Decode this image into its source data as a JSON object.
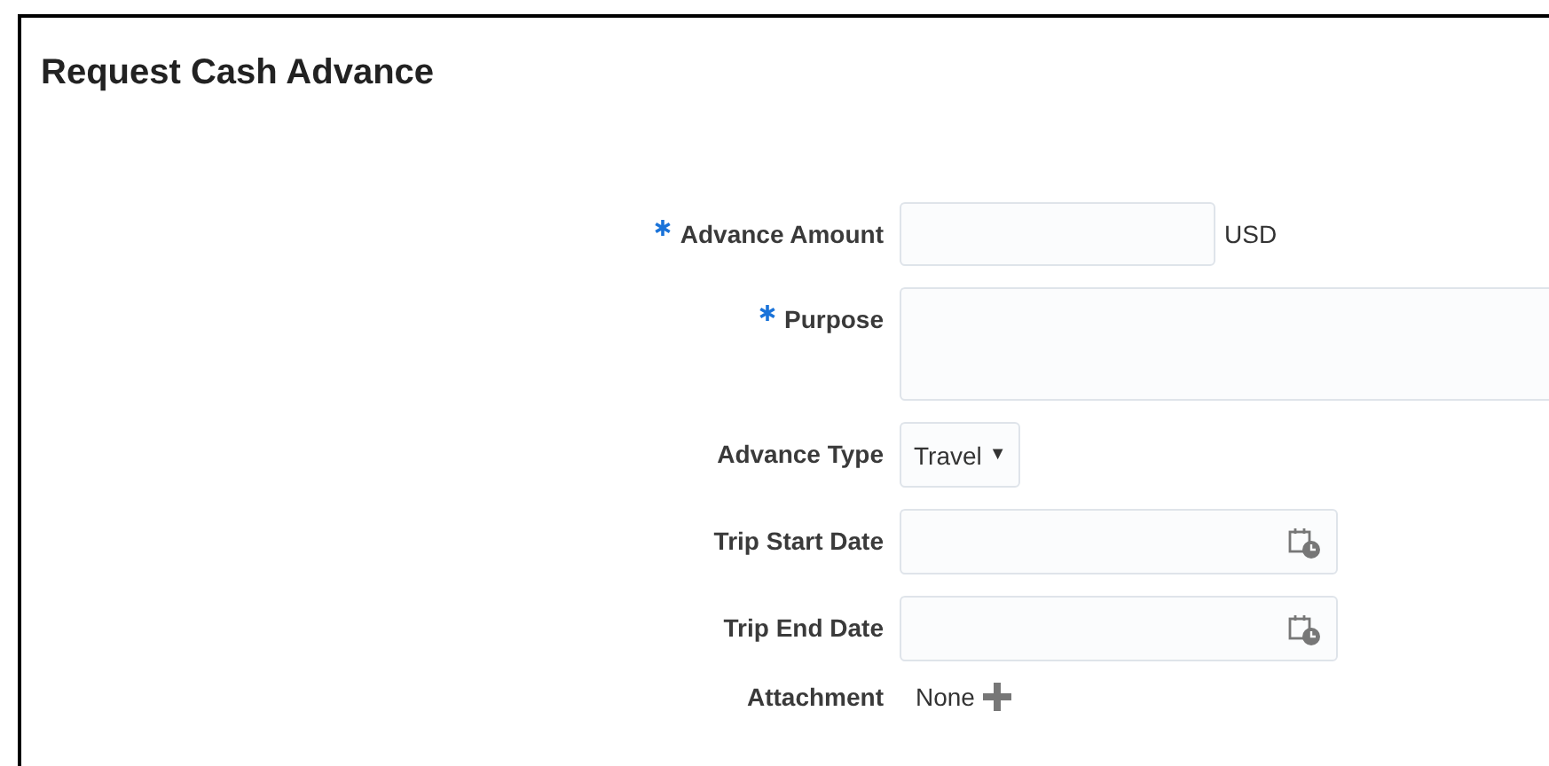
{
  "page": {
    "title": "Request Cash Advance"
  },
  "fields": [
    {
      "kind": "text",
      "label": "Advance Amount",
      "required": true,
      "unit": "USD"
    },
    {
      "kind": "textarea",
      "label": "Purpose",
      "required": true
    },
    {
      "kind": "select",
      "label": "Advance Type",
      "required": false,
      "value": "Travel",
      "caret": "▼"
    },
    {
      "kind": "date",
      "label": "Trip Start Date",
      "required": false
    },
    {
      "kind": "date",
      "label": "Trip End Date",
      "required": false
    },
    {
      "kind": "attachment",
      "label": "Attachment",
      "required": false,
      "value": "None"
    }
  ]
}
